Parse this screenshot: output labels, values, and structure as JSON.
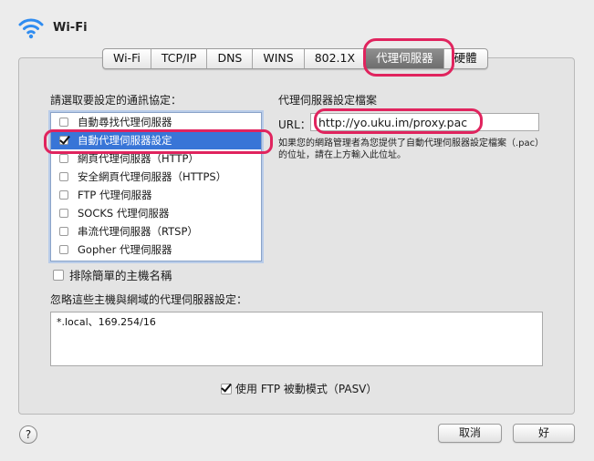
{
  "header": {
    "title": "Wi-Fi"
  },
  "tabs": [
    {
      "label": "Wi-Fi"
    },
    {
      "label": "TCP/IP"
    },
    {
      "label": "DNS"
    },
    {
      "label": "WINS"
    },
    {
      "label": "802.1X"
    },
    {
      "label": "代理伺服器"
    },
    {
      "label": "硬體"
    }
  ],
  "protocols": {
    "label": "請選取要設定的通訊協定：",
    "items": [
      {
        "label": "自動尋找代理伺服器",
        "checked": false
      },
      {
        "label": "自動代理伺服器設定",
        "checked": true
      },
      {
        "label": "網頁代理伺服器（HTTP）",
        "checked": false
      },
      {
        "label": "安全網頁代理伺服器（HTTPS）",
        "checked": false
      },
      {
        "label": "FTP 代理伺服器",
        "checked": false
      },
      {
        "label": "SOCKS 代理伺服器",
        "checked": false
      },
      {
        "label": "串流代理伺服器（RTSP）",
        "checked": false
      },
      {
        "label": "Gopher 代理伺服器",
        "checked": false
      }
    ]
  },
  "config": {
    "title": "代理伺服器設定檔案",
    "url_label": "URL：",
    "url_value": "http://yo.uku.im/proxy.pac",
    "hint": "如果您的網路管理者為您提供了自動代理伺服器設定檔案（.pac）的位址，請在上方輸入此位址。"
  },
  "exclude_simple": {
    "label": "排除簡單的主機名稱",
    "checked": false
  },
  "bypass": {
    "label": "忽略這些主機與網域的代理伺服器設定：",
    "value": "*.local、169.254/16"
  },
  "pasv": {
    "label": "使用 FTP 被動模式（PASV）",
    "checked": true
  },
  "buttons": {
    "help": "?",
    "cancel": "取消",
    "ok": "好"
  },
  "colors": {
    "highlight": "#e0245e",
    "selection": "#3875d7"
  }
}
